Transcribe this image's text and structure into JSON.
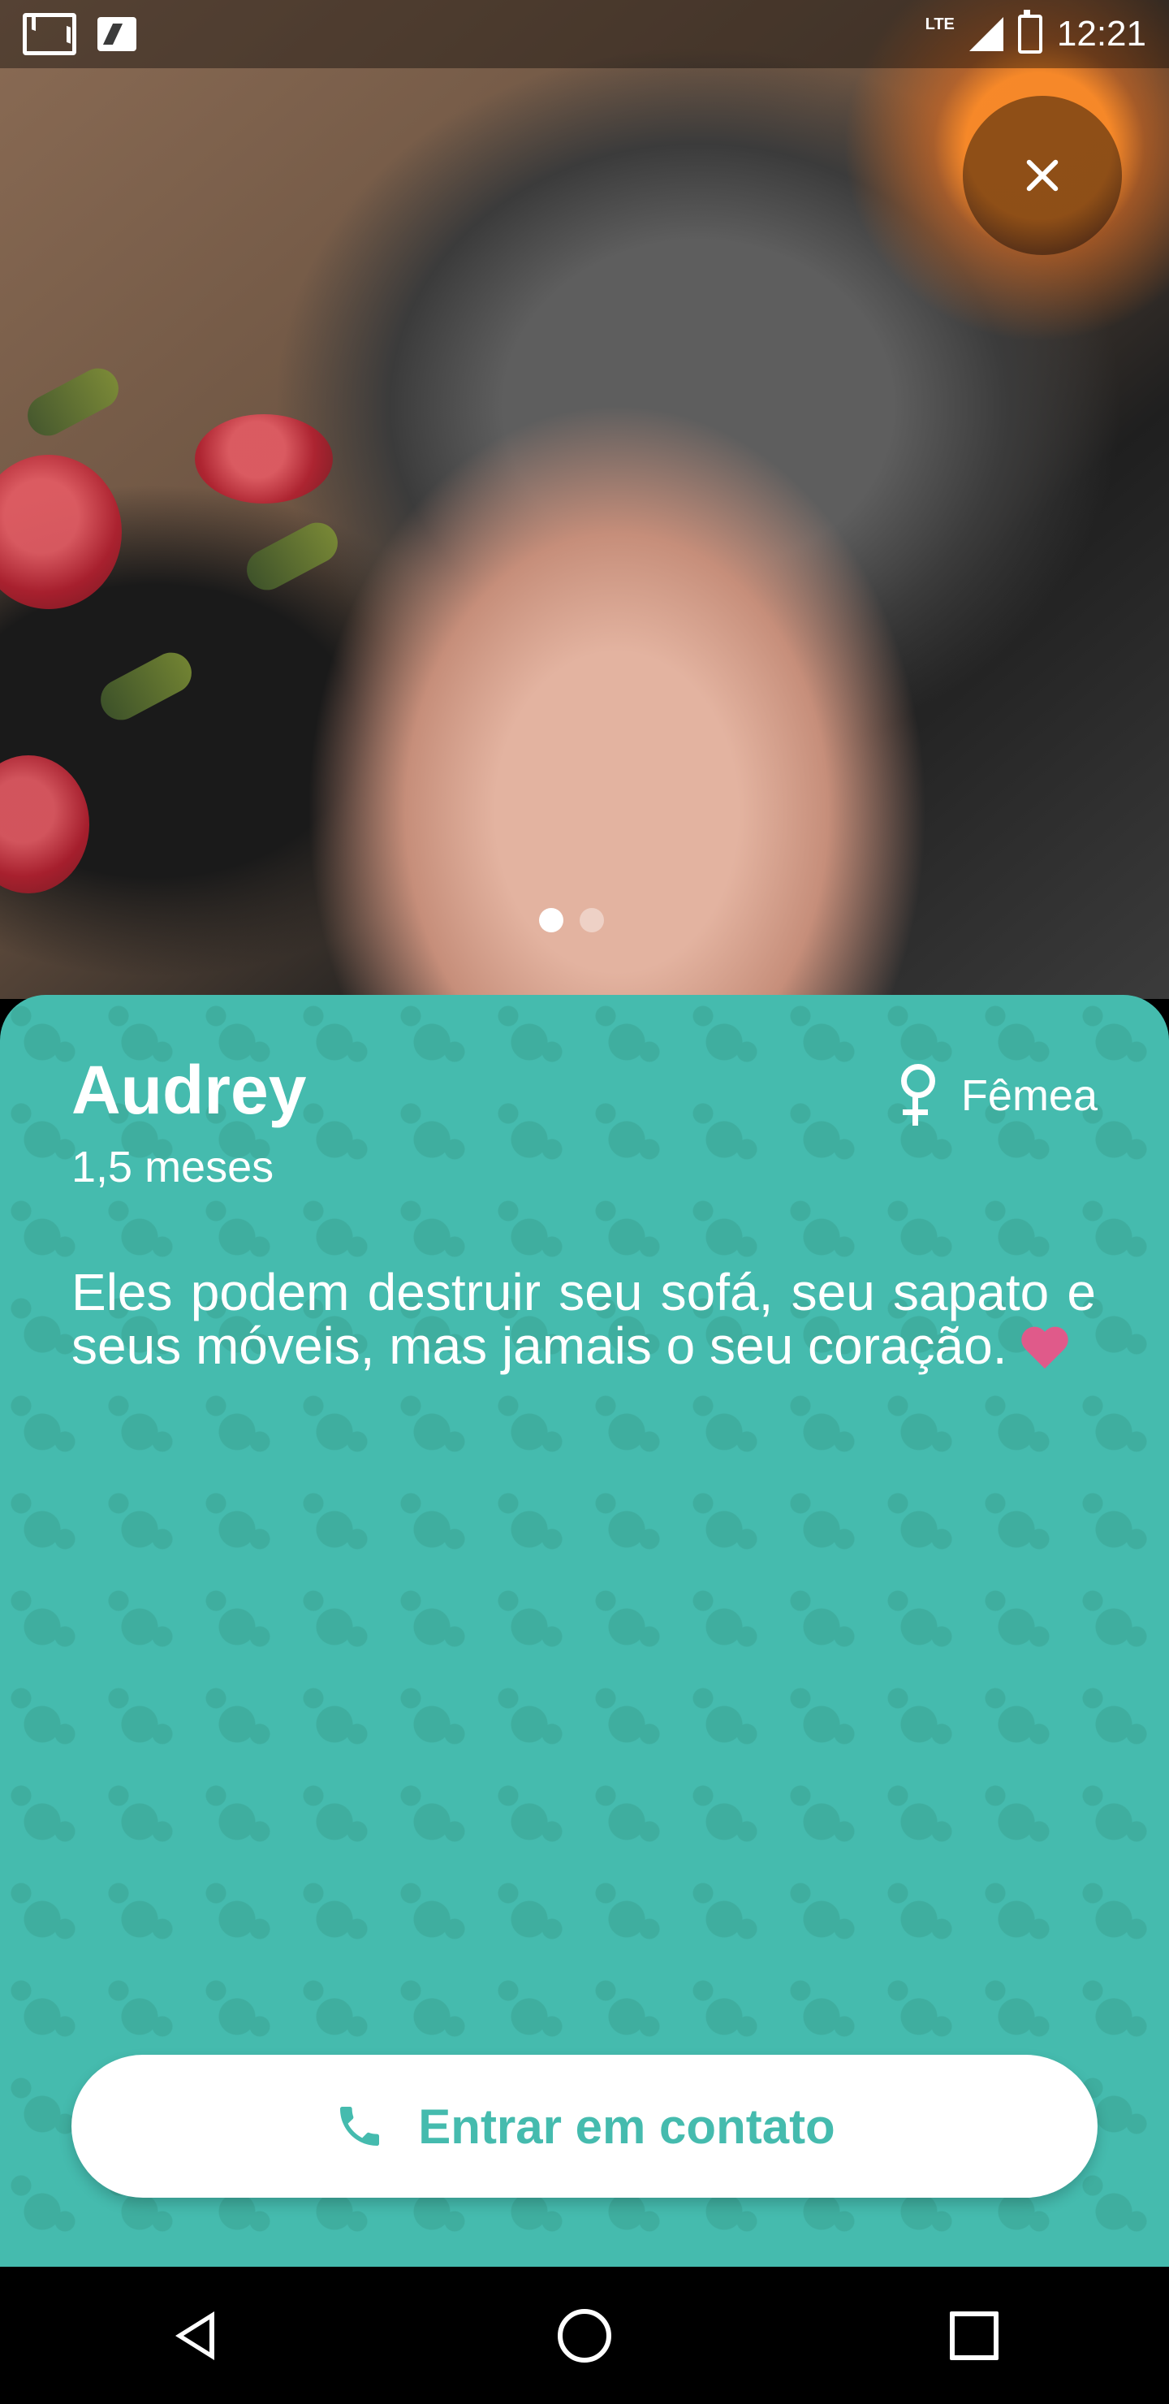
{
  "status_bar": {
    "time": "12:21",
    "network": "LTE",
    "icons": [
      "gmail-icon",
      "notification-n-icon",
      "signal-icon",
      "battery-charging-icon"
    ]
  },
  "carousel": {
    "total": 2,
    "current": 1
  },
  "pet": {
    "name": "Audrey",
    "age": "1,5 meses",
    "gender": "Fêmea",
    "description": "Eles podem destruir seu sofá, seu sapato e seus móveis, mas jamais o seu coração."
  },
  "contact_button": {
    "label": "Entrar em contato"
  },
  "colors": {
    "accent": "#45bbae",
    "heart": "#e05a8a"
  }
}
